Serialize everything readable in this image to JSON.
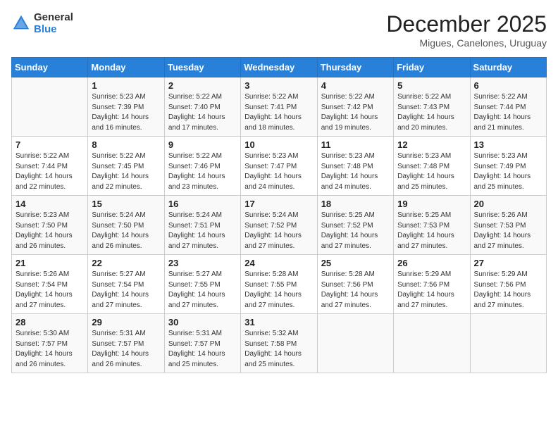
{
  "header": {
    "logo_general": "General",
    "logo_blue": "Blue",
    "month_title": "December 2025",
    "location": "Migues, Canelones, Uruguay"
  },
  "days_of_week": [
    "Sunday",
    "Monday",
    "Tuesday",
    "Wednesday",
    "Thursday",
    "Friday",
    "Saturday"
  ],
  "weeks": [
    [
      {
        "day": "",
        "info": ""
      },
      {
        "day": "1",
        "info": "Sunrise: 5:23 AM\nSunset: 7:39 PM\nDaylight: 14 hours\nand 16 minutes."
      },
      {
        "day": "2",
        "info": "Sunrise: 5:22 AM\nSunset: 7:40 PM\nDaylight: 14 hours\nand 17 minutes."
      },
      {
        "day": "3",
        "info": "Sunrise: 5:22 AM\nSunset: 7:41 PM\nDaylight: 14 hours\nand 18 minutes."
      },
      {
        "day": "4",
        "info": "Sunrise: 5:22 AM\nSunset: 7:42 PM\nDaylight: 14 hours\nand 19 minutes."
      },
      {
        "day": "5",
        "info": "Sunrise: 5:22 AM\nSunset: 7:43 PM\nDaylight: 14 hours\nand 20 minutes."
      },
      {
        "day": "6",
        "info": "Sunrise: 5:22 AM\nSunset: 7:44 PM\nDaylight: 14 hours\nand 21 minutes."
      }
    ],
    [
      {
        "day": "7",
        "info": "Sunrise: 5:22 AM\nSunset: 7:44 PM\nDaylight: 14 hours\nand 22 minutes."
      },
      {
        "day": "8",
        "info": "Sunrise: 5:22 AM\nSunset: 7:45 PM\nDaylight: 14 hours\nand 22 minutes."
      },
      {
        "day": "9",
        "info": "Sunrise: 5:22 AM\nSunset: 7:46 PM\nDaylight: 14 hours\nand 23 minutes."
      },
      {
        "day": "10",
        "info": "Sunrise: 5:23 AM\nSunset: 7:47 PM\nDaylight: 14 hours\nand 24 minutes."
      },
      {
        "day": "11",
        "info": "Sunrise: 5:23 AM\nSunset: 7:48 PM\nDaylight: 14 hours\nand 24 minutes."
      },
      {
        "day": "12",
        "info": "Sunrise: 5:23 AM\nSunset: 7:48 PM\nDaylight: 14 hours\nand 25 minutes."
      },
      {
        "day": "13",
        "info": "Sunrise: 5:23 AM\nSunset: 7:49 PM\nDaylight: 14 hours\nand 25 minutes."
      }
    ],
    [
      {
        "day": "14",
        "info": "Sunrise: 5:23 AM\nSunset: 7:50 PM\nDaylight: 14 hours\nand 26 minutes."
      },
      {
        "day": "15",
        "info": "Sunrise: 5:24 AM\nSunset: 7:50 PM\nDaylight: 14 hours\nand 26 minutes."
      },
      {
        "day": "16",
        "info": "Sunrise: 5:24 AM\nSunset: 7:51 PM\nDaylight: 14 hours\nand 27 minutes."
      },
      {
        "day": "17",
        "info": "Sunrise: 5:24 AM\nSunset: 7:52 PM\nDaylight: 14 hours\nand 27 minutes."
      },
      {
        "day": "18",
        "info": "Sunrise: 5:25 AM\nSunset: 7:52 PM\nDaylight: 14 hours\nand 27 minutes."
      },
      {
        "day": "19",
        "info": "Sunrise: 5:25 AM\nSunset: 7:53 PM\nDaylight: 14 hours\nand 27 minutes."
      },
      {
        "day": "20",
        "info": "Sunrise: 5:26 AM\nSunset: 7:53 PM\nDaylight: 14 hours\nand 27 minutes."
      }
    ],
    [
      {
        "day": "21",
        "info": "Sunrise: 5:26 AM\nSunset: 7:54 PM\nDaylight: 14 hours\nand 27 minutes."
      },
      {
        "day": "22",
        "info": "Sunrise: 5:27 AM\nSunset: 7:54 PM\nDaylight: 14 hours\nand 27 minutes."
      },
      {
        "day": "23",
        "info": "Sunrise: 5:27 AM\nSunset: 7:55 PM\nDaylight: 14 hours\nand 27 minutes."
      },
      {
        "day": "24",
        "info": "Sunrise: 5:28 AM\nSunset: 7:55 PM\nDaylight: 14 hours\nand 27 minutes."
      },
      {
        "day": "25",
        "info": "Sunrise: 5:28 AM\nSunset: 7:56 PM\nDaylight: 14 hours\nand 27 minutes."
      },
      {
        "day": "26",
        "info": "Sunrise: 5:29 AM\nSunset: 7:56 PM\nDaylight: 14 hours\nand 27 minutes."
      },
      {
        "day": "27",
        "info": "Sunrise: 5:29 AM\nSunset: 7:56 PM\nDaylight: 14 hours\nand 27 minutes."
      }
    ],
    [
      {
        "day": "28",
        "info": "Sunrise: 5:30 AM\nSunset: 7:57 PM\nDaylight: 14 hours\nand 26 minutes."
      },
      {
        "day": "29",
        "info": "Sunrise: 5:31 AM\nSunset: 7:57 PM\nDaylight: 14 hours\nand 26 minutes."
      },
      {
        "day": "30",
        "info": "Sunrise: 5:31 AM\nSunset: 7:57 PM\nDaylight: 14 hours\nand 25 minutes."
      },
      {
        "day": "31",
        "info": "Sunrise: 5:32 AM\nSunset: 7:58 PM\nDaylight: 14 hours\nand 25 minutes."
      },
      {
        "day": "",
        "info": ""
      },
      {
        "day": "",
        "info": ""
      },
      {
        "day": "",
        "info": ""
      }
    ]
  ]
}
